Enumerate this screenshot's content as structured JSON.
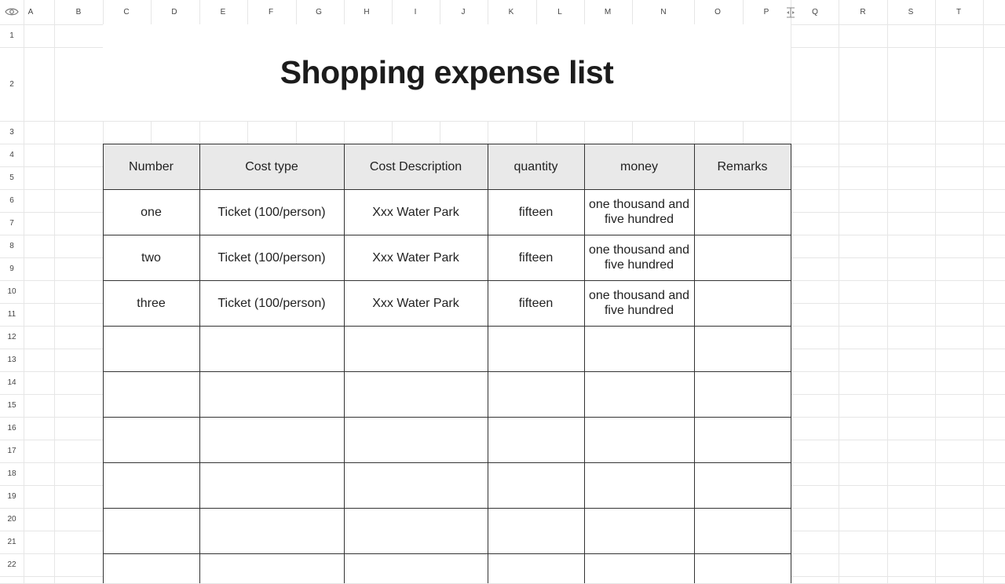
{
  "sheet": {
    "columns": [
      "A",
      "B",
      "C",
      "D",
      "E",
      "F",
      "G",
      "H",
      "I",
      "J",
      "K",
      "L",
      "M",
      "N",
      "O",
      "P",
      "Q",
      "R",
      "S",
      "T"
    ],
    "rows": [
      "1",
      "2",
      "3",
      "4",
      "5",
      "6",
      "7",
      "8",
      "9",
      "10",
      "11",
      "12",
      "13",
      "14",
      "15",
      "16",
      "17",
      "18",
      "19",
      "20",
      "21",
      "22"
    ],
    "title": "Shopping expense list"
  },
  "table": {
    "headers": [
      "Number",
      "Cost type",
      "Cost Description",
      "quantity",
      "money",
      "Remarks"
    ],
    "rows": [
      [
        "one",
        "Ticket (100/person)",
        "Xxx Water Park",
        "fifteen",
        "one thousand and five hundred",
        ""
      ],
      [
        "two",
        "Ticket (100/person)",
        "Xxx Water Park",
        "fifteen",
        "one thousand and five hundred",
        ""
      ],
      [
        "three",
        "Ticket (100/person)",
        "Xxx Water Park",
        "fifteen",
        "one thousand and five hundred",
        ""
      ],
      [
        "",
        "",
        "",
        "",
        "",
        ""
      ],
      [
        "",
        "",
        "",
        "",
        "",
        ""
      ],
      [
        "",
        "",
        "",
        "",
        "",
        ""
      ],
      [
        "",
        "",
        "",
        "",
        "",
        ""
      ],
      [
        "",
        "",
        "",
        "",
        "",
        ""
      ],
      [
        "",
        "",
        "",
        "",
        "",
        ""
      ]
    ]
  },
  "icons": {
    "corner": "eye-icon",
    "freeze": "freeze-column-icon"
  }
}
